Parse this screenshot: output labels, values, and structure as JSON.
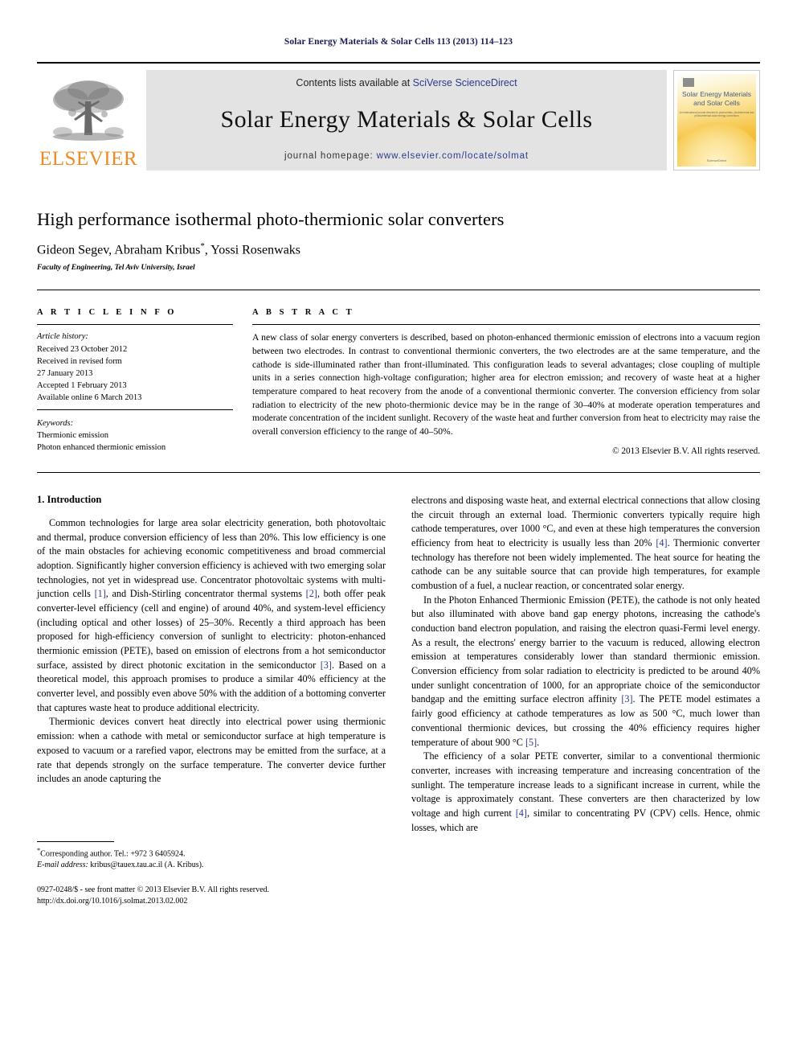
{
  "running_head": "Solar Energy Materials & Solar Cells 113 (2013) 114–123",
  "masthead": {
    "contents_prefix": "Contents lists available at ",
    "contents_link": "SciVerse ScienceDirect",
    "journal_title": "Solar Energy Materials & Solar Cells",
    "homepage_prefix": "journal homepage: ",
    "homepage_link": "www.elsevier.com/locate/solmat",
    "publisher_wordmark": "ELSEVIER",
    "cover": {
      "title_line1": "Solar Energy Materials",
      "title_line2": "and Solar Cells",
      "subtitle": "An international journal devoted to photovoltaic, photothermal and photochemical solar energy conversion",
      "footer": "ScienceDirect"
    }
  },
  "article": {
    "title": "High performance isothermal photo-thermionic solar converters",
    "authors": "Gideon Segev, Abraham Kribus",
    "authors_tail": ", Yossi Rosenwaks",
    "corresponding_marker": "*",
    "affiliation": "Faculty of Engineering, Tel Aviv University, Israel"
  },
  "info": {
    "label": "A R T I C L E   I N F O",
    "history_header": "Article history:",
    "history": [
      "Received 23 October 2012",
      "Received in revised form",
      "27 January 2013",
      "Accepted 1 February 2013",
      "Available online 6 March 2013"
    ],
    "keywords_header": "Keywords:",
    "keywords": [
      "Thermionic emission",
      "Photon enhanced thermionic emission"
    ]
  },
  "abstract": {
    "label": "A B S T R A C T",
    "text": "A new class of solar energy converters is described, based on photon-enhanced thermionic emission of electrons into a vacuum region between two electrodes. In contrast to conventional thermionic converters, the two electrodes are at the same temperature, and the cathode is side-illuminated rather than front-illuminated. This configuration leads to several advantages; close coupling of multiple units in a series connection high-voltage configuration; higher area for electron emission; and recovery of waste heat at a higher temperature compared to heat recovery from the anode of a conventional thermionic converter. The conversion efficiency from solar radiation to electricity of the new photo-thermionic device may be in the range of 30–40% at moderate operation temperatures and moderate concentration of the incident sunlight. Recovery of the waste heat and further conversion from heat to electricity may raise the overall conversion efficiency to the range of 40–50%.",
    "copyright": "© 2013 Elsevier B.V. All rights reserved."
  },
  "body": {
    "section_number_title": "1.  Introduction",
    "left_paragraphs": [
      "Common technologies for large area solar electricity generation, both photovoltaic and thermal, produce conversion efficiency of less than 20%. This low efficiency is one of the main obstacles for achieving economic competitiveness and broad commercial adoption. Significantly higher conversion efficiency is achieved with two emerging solar technologies, not yet in widespread use. Concentrator photovoltaic systems with multi-junction cells [1], and Dish-Stirling concentrator thermal systems [2], both offer peak converter-level efficiency (cell and engine) of around 40%, and system-level efficiency (including optical and other losses) of 25–30%. Recently a third approach has been proposed for high-efficiency conversion of sunlight to electricity: photon-enhanced thermionic emission (PETE), based on emission of electrons from a hot semiconductor surface, assisted by direct photonic excitation in the semiconductor [3]. Based on a theoretical model, this approach promises to produce a similar 40% efficiency at the converter level, and possibly even above 50% with the addition of a bottoming converter that captures waste heat to produce additional electricity.",
      "Thermionic devices convert heat directly into electrical power using thermionic emission: when a cathode with metal or semiconductor surface at high temperature is exposed to vacuum or a rarefied vapor, electrons may be emitted from the surface, at a rate that depends strongly on the surface temperature. The converter device further includes an anode capturing the"
    ],
    "right_paragraphs": [
      "electrons and disposing waste heat, and external electrical connections that allow closing the circuit through an external load. Thermionic converters typically require high cathode temperatures, over 1000 °C, and even at these high temperatures the conversion efficiency from heat to electricity is usually less than 20% [4]. Thermionic converter technology has therefore not been widely implemented. The heat source for heating the cathode can be any suitable source that can provide high temperatures, for example combustion of a fuel, a nuclear reaction, or concentrated solar energy.",
      "In the Photon Enhanced Thermionic Emission (PETE), the cathode is not only heated but also illuminated with above band gap energy photons, increasing the cathode's conduction band electron population, and raising the electron quasi-Fermi level energy. As a result, the electrons' energy barrier to the vacuum is reduced, allowing electron emission at temperatures considerably lower than standard thermionic emission. Conversion efficiency from solar radiation to electricity is predicted to be around 40% under sunlight concentration of 1000, for an appropriate choice of the semiconductor bandgap and the emitting surface electron affinity [3]. The PETE model estimates a fairly good efficiency at cathode temperatures as low as 500 °C, much lower than conventional thermionic devices, but crossing the 40% efficiency requires higher temperature of about 900 °C [5].",
      "The efficiency of a solar PETE converter, similar to a conventional thermionic converter, increases with increasing temperature and increasing concentration of the sunlight. The temperature increase leads to a significant increase in current, while the voltage is approximately constant. These converters are then characterized by low voltage and high current [4], similar to concentrating PV (CPV) cells. Hence, ohmic losses, which are"
    ]
  },
  "footnote": {
    "corresponding_marker": "*",
    "corresponding": "Corresponding author. Tel.: +972 3 6405924.",
    "email_label": "E-mail address:",
    "email": " kribus@tauex.tau.ac.il (A. Kribus)."
  },
  "imprint": {
    "line1": "0927-0248/$ - see front matter © 2013 Elsevier B.V. All rights reserved.",
    "line2": "http://dx.doi.org/10.1016/j.solmat.2013.02.002"
  },
  "colors": {
    "link_blue": "#2b3a8f",
    "elsevier_orange": "#ED8B22",
    "running_head": "#1b1b55",
    "band_gray": "#e3e3e3"
  }
}
